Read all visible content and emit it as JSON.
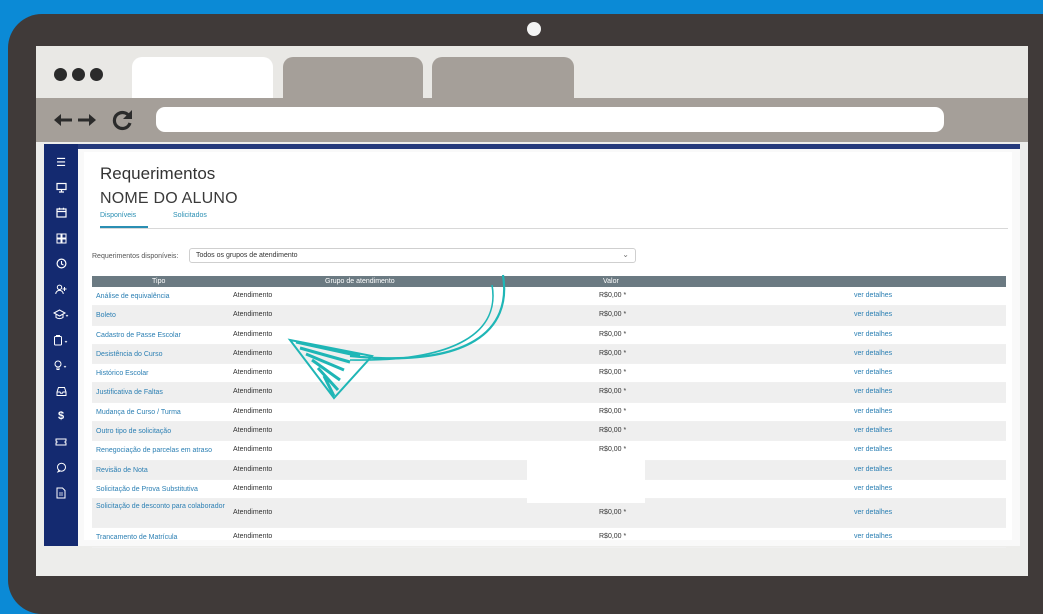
{
  "page": {
    "title": "Requerimentos",
    "student_name": "NOME DO ALUNO",
    "tabs": [
      {
        "label": "Disponíveis"
      },
      {
        "label": "Solicitados"
      }
    ]
  },
  "filter": {
    "label": "Requerimentos disponíveis:",
    "value": "Todos os grupos de atendimento"
  },
  "table": {
    "headers": [
      "Tipo",
      "Grupo de atendimento",
      "Valor"
    ],
    "rows": [
      {
        "tipo": "Análise de equivalência",
        "grupo": "Atendimento",
        "valor": "R$0,00 *",
        "link": "ver detalhes"
      },
      {
        "tipo": "Boleto",
        "grupo": "Atendimento",
        "valor": "R$0,00 *",
        "link": "ver detalhes"
      },
      {
        "tipo": "Cadastro de Passe Escolar",
        "grupo": "Atendimento",
        "valor": "R$0,00 *",
        "link": "ver detalhes"
      },
      {
        "tipo": "Desistência do Curso",
        "grupo": "Atendimento",
        "valor": "R$0,00 *",
        "link": "ver detalhes"
      },
      {
        "tipo": "Histórico Escolar",
        "grupo": "Atendimento",
        "valor": "R$0,00 *",
        "link": "ver detalhes"
      },
      {
        "tipo": "Justificativa de Faltas",
        "grupo": "Atendimento",
        "valor": "R$0,00 *",
        "link": "ver detalhes"
      },
      {
        "tipo": "Mudança de Curso / Turma",
        "grupo": "Atendimento",
        "valor": "R$0,00 *",
        "link": "ver detalhes"
      },
      {
        "tipo": "Outro tipo de solicitação",
        "grupo": "Atendimento",
        "valor": "R$0,00 *",
        "link": "ver detalhes"
      },
      {
        "tipo": "Renegociação de parcelas em atraso",
        "grupo": "Atendimento",
        "valor": "R$0,00 *",
        "link": "ver detalhes"
      },
      {
        "tipo": "Revisão de Nota",
        "grupo": "Atendimento",
        "valor": "",
        "link": "ver detalhes"
      },
      {
        "tipo": "Solicitação de Prova Substitutiva",
        "grupo": "Atendimento",
        "valor": "",
        "link": "ver detalhes"
      },
      {
        "tipo": "Solicitação de desconto para colaborador",
        "grupo": "Atendimento",
        "valor": "R$0,00 *",
        "link": "ver detalhes"
      },
      {
        "tipo": "Trancamento de Matrícula",
        "grupo": "Atendimento",
        "valor": "R$0,00 *",
        "link": "ver detalhes"
      }
    ]
  },
  "sidebar": {
    "icons": [
      "menu-icon",
      "monitor-icon",
      "calendar-icon",
      "grid-icon",
      "clock-icon",
      "add-user-icon",
      "graduation-cap-icon",
      "clipboard-icon",
      "lightbulb-icon",
      "inbox-icon",
      "dollar-icon",
      "ticket-icon",
      "chat-icon",
      "document-icon"
    ]
  },
  "colors": {
    "background": "#0b8ad6",
    "device_frame": "#403a39",
    "sidebar": "#142a70",
    "table_header": "#6b7a82",
    "link": "#2b7fb3",
    "annotation_arrow": "#1fb6b6"
  }
}
